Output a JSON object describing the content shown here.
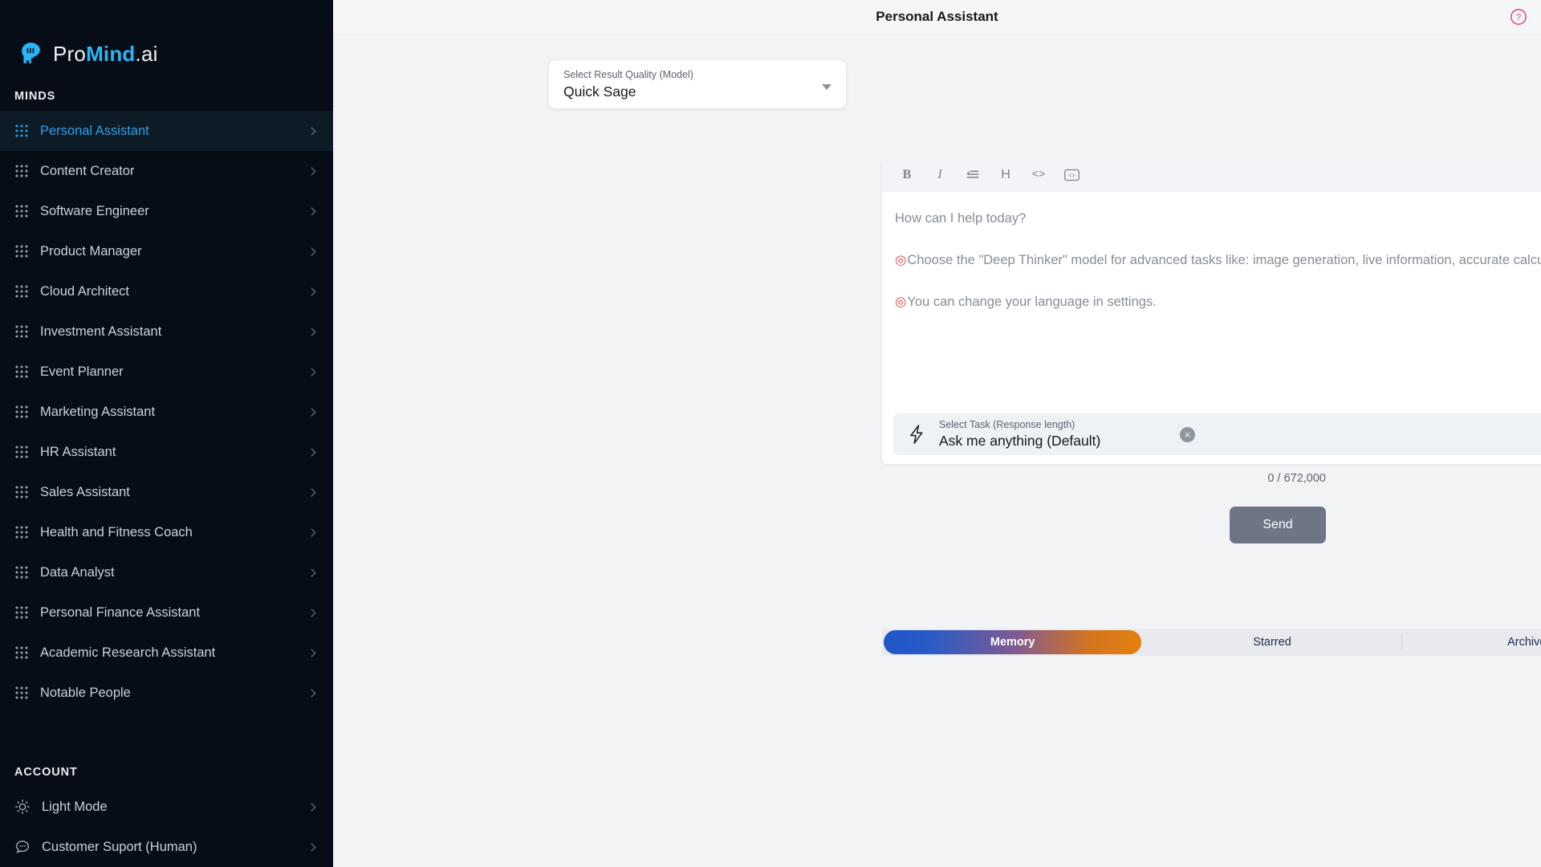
{
  "sidebar": {
    "logo": {
      "part1": "Pro",
      "part2": "Mind",
      "part3": ".ai",
      "icon": "brain-head-icon"
    },
    "minds_label": "MINDS",
    "minds": [
      {
        "label": "Personal Assistant",
        "icon": "grid-dots-icon",
        "active": true
      },
      {
        "label": "Content Creator",
        "icon": "grid-dots-icon",
        "active": false
      },
      {
        "label": "Software Engineer",
        "icon": "grid-dots-icon",
        "active": false
      },
      {
        "label": "Product Manager",
        "icon": "grid-dots-icon",
        "active": false
      },
      {
        "label": "Cloud Architect",
        "icon": "grid-dots-icon",
        "active": false
      },
      {
        "label": "Investment Assistant",
        "icon": "grid-dots-icon",
        "active": false
      },
      {
        "label": "Event Planner",
        "icon": "grid-dots-icon",
        "active": false
      },
      {
        "label": "Marketing Assistant",
        "icon": "grid-dots-icon",
        "active": false
      },
      {
        "label": "HR Assistant",
        "icon": "grid-dots-icon",
        "active": false
      },
      {
        "label": "Sales Assistant",
        "icon": "grid-dots-icon",
        "active": false
      },
      {
        "label": "Health and Fitness Coach",
        "icon": "grid-dots-icon",
        "active": false
      },
      {
        "label": "Data Analyst",
        "icon": "grid-dots-icon",
        "active": false
      },
      {
        "label": "Personal Finance Assistant",
        "icon": "grid-dots-icon",
        "active": false
      },
      {
        "label": "Academic Research Assistant",
        "icon": "grid-dots-icon",
        "active": false
      },
      {
        "label": "Notable People",
        "icon": "grid-dots-icon",
        "active": false
      }
    ],
    "account_label": "ACCOUNT",
    "account": [
      {
        "label": "Light Mode",
        "icon": "sun-icon"
      },
      {
        "label": "Customer Suport (Human)",
        "icon": "chat-bubble-icon"
      }
    ]
  },
  "header": {
    "title": "Personal Assistant",
    "help_icon": "question-circle-icon"
  },
  "model_select": {
    "label": "Select Result Quality (Model)",
    "value": "Quick Sage",
    "caret_icon": "chevron-down-icon"
  },
  "editor": {
    "toolbar": [
      {
        "name": "bold-button",
        "glyph": "B"
      },
      {
        "name": "italic-button",
        "glyph": "I"
      },
      {
        "name": "list-button",
        "glyph": "list"
      },
      {
        "name": "heading-button",
        "glyph": "H"
      },
      {
        "name": "inline-code-button",
        "glyph": "<>"
      },
      {
        "name": "code-block-button",
        "glyph": "code-block"
      }
    ],
    "placeholder": "How can I help today?",
    "hint_bullet": "◎",
    "hint_1": "Choose the \"Deep Thinker\" model for advanced tasks like: image generation, live information, accurate calculations.",
    "hint_2": "You can change your language in settings.",
    "task": {
      "icon": "lightning-bolt-icon",
      "label": "Select Task (Response length)",
      "value": "Ask me anything (Default)",
      "clear_icon": "close-circle-icon",
      "clear_glyph": "×"
    },
    "counter": "0 / 672,000",
    "send_label": "Send"
  },
  "tabs": [
    {
      "label": "Memory",
      "active": true
    },
    {
      "label": "Starred",
      "active": false
    },
    {
      "label": "Archived",
      "active": false
    }
  ],
  "colors": {
    "sidebar_bg": "#070d16",
    "accent_blue": "#29b6f6",
    "active_item": "#2f9ee8",
    "help_pink": "#e8416d",
    "tab_gradient_start": "#1f56c9",
    "tab_gradient_end": "#e3800f",
    "send_button": "#6e7686"
  }
}
